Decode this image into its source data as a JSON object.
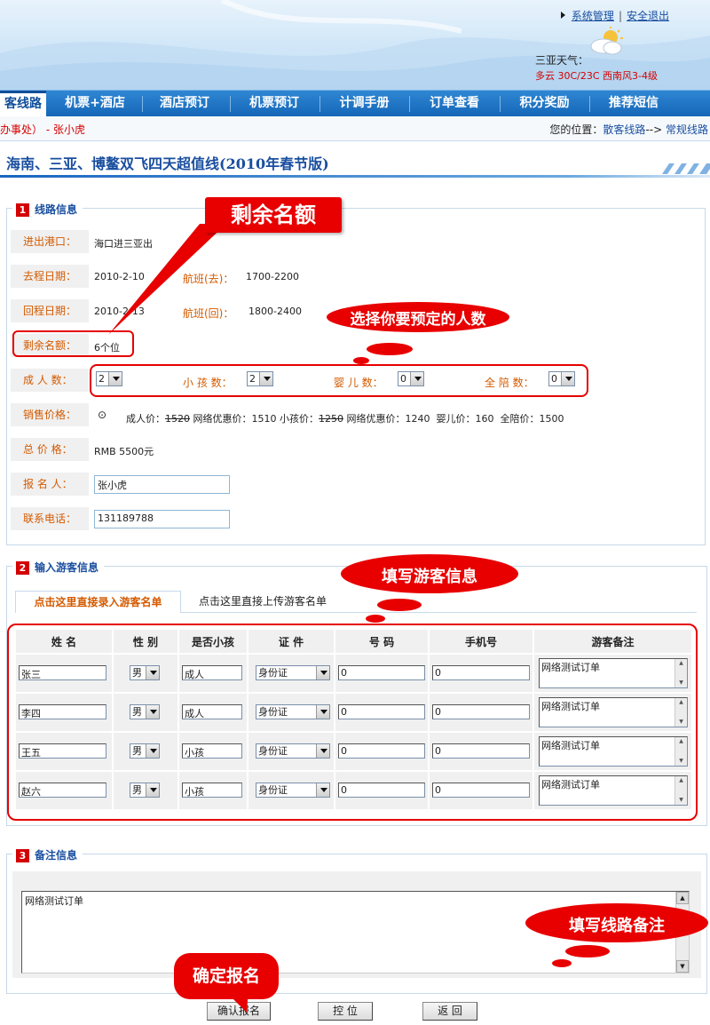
{
  "header": {
    "link_admin": "系统管理",
    "link_separator": "|",
    "link_logout": "安全退出",
    "weather_title": "三亚天气：",
    "weather_info": "多云 30C/23C 西南风3-4级"
  },
  "nav": {
    "items": [
      "客线路",
      "机票+酒店",
      "酒店预订",
      "机票预订",
      "计调手册",
      "订单查看",
      "积分奖励",
      "推荐短信"
    ]
  },
  "crumb": {
    "left": "办事处） - 张小虎",
    "right_prefix": "您的位置：",
    "right_link1": "散客线路",
    "right_arrow": "-->",
    "right_link2": "常规线路"
  },
  "route_title": "海南、三亚、博鳌双飞四天超值线(2010年春节版)",
  "section1": {
    "num": "1",
    "title": "线路信息",
    "port_label": "进出港口：",
    "port_value": "海口进三亚出",
    "depart_label": "去程日期：",
    "depart_value": "2010-2-10",
    "flight_out_label": "航班(去)：",
    "flight_out_value": "1700-2200",
    "return_label": "回程日期：",
    "return_value": "2010-2-13",
    "flight_back_label": "航班(回)：",
    "flight_back_value": "1800-2400",
    "remaining_label": "剩余名额：",
    "remaining_value": "6个位",
    "adult_label": "成 人 数：",
    "adult_value": "2",
    "child_label": "小 孩 数：",
    "child_value": "2",
    "infant_label": "婴 儿 数：",
    "infant_value": "0",
    "escort_label": "全 陪 数：",
    "escort_value": "0",
    "price_label": "销售价格：",
    "price_radio": "⊙",
    "price_adult": "成人价：",
    "price_adult_old": "1520",
    "price_adult_online": "网络优惠价：1510",
    "price_child": "小孩价：",
    "price_child_old": "1250",
    "price_child_online": "网络优惠价：1240",
    "price_infant": "婴儿价：160",
    "price_escort": "全陪价：1500",
    "total_label": "总 价 格：",
    "total_value": "RMB 5500元",
    "applicant_label": "报 名 人：",
    "applicant_value": "张小虎",
    "phone_label": "联系电话：",
    "phone_value": "131189788"
  },
  "section2": {
    "num": "2",
    "title": "输入游客信息",
    "tab_manual": "点击这里直接录入游客名单",
    "tab_upload": "点击这里直接上传游客名单",
    "columns": [
      "姓 名",
      "性 别",
      "是否小孩",
      "证 件",
      "号 码",
      "手机号",
      "游客备注"
    ],
    "rows": [
      {
        "name": "张三",
        "gender": "男",
        "child": "成人",
        "id_type": "身份证",
        "id_no": "0",
        "mobile": "0",
        "note": "网络测试订单"
      },
      {
        "name": "李四",
        "gender": "男",
        "child": "成人",
        "id_type": "身份证",
        "id_no": "0",
        "mobile": "0",
        "note": "网络测试订单"
      },
      {
        "name": "王五",
        "gender": "男",
        "child": "小孩",
        "id_type": "身份证",
        "id_no": "0",
        "mobile": "0",
        "note": "网络测试订单"
      },
      {
        "name": "赵六",
        "gender": "男",
        "child": "小孩",
        "id_type": "身份证",
        "id_no": "0",
        "mobile": "0",
        "note": "网络测试订单"
      }
    ]
  },
  "section3": {
    "num": "3",
    "title": "备注信息",
    "note_value": "网络测试订单"
  },
  "buttons": {
    "confirm": "确认报名",
    "hold": "控 位",
    "back": "返 回"
  },
  "annotations": {
    "remaining": "剩余名额",
    "select_people": "选择你要预定的人数",
    "fill_guests": "填写游客信息",
    "fill_note": "填写线路备注",
    "confirm": "确定报名"
  },
  "colors": {
    "nav_blue": "#1566b8",
    "title_blue": "#1a4fa0",
    "label_orange": "#d45a00",
    "annotation_red": "#e80000"
  }
}
